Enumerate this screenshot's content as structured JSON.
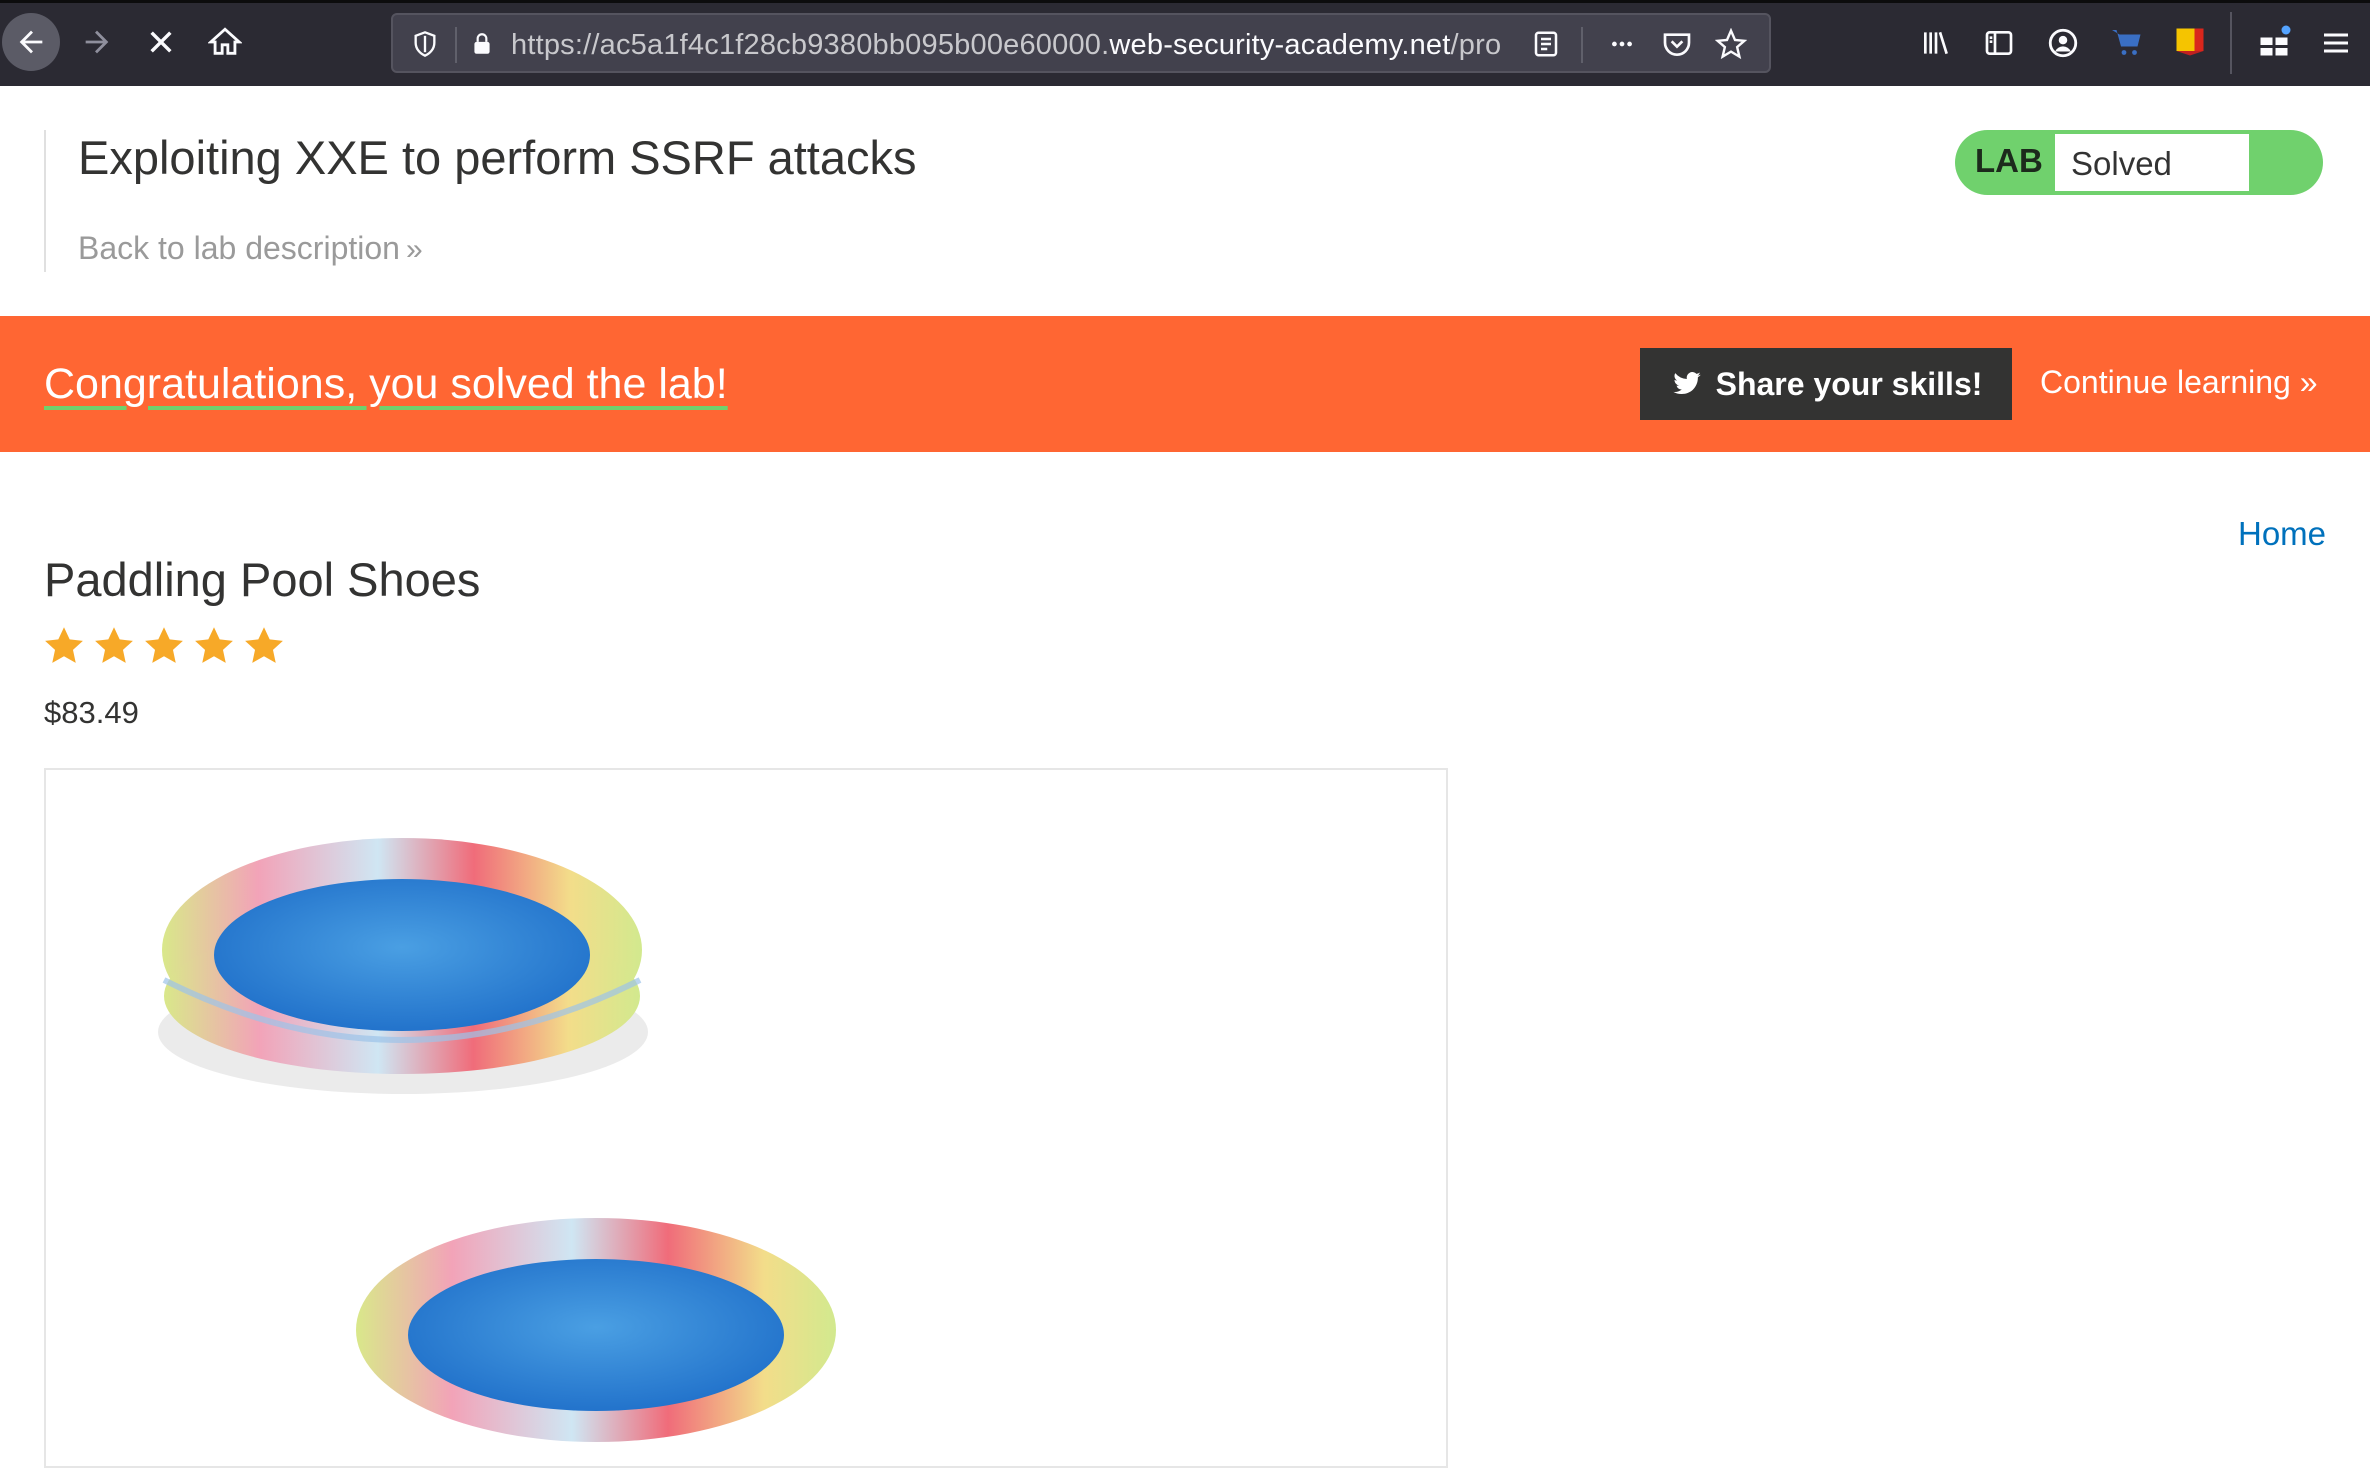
{
  "browser": {
    "url_prefix": "https://ac5a1f4c1f28cb9380bb095b00e60000.",
    "url_domain": "web-security-academy.net",
    "url_suffix": "/pro"
  },
  "header": {
    "title": "Exploiting XXE to perform SSRF attacks",
    "back_link": "Back to lab description",
    "status_label": "LAB",
    "status_value": "Solved"
  },
  "banner": {
    "message": "Congratulations, you solved the lab!",
    "share_label": "Share your skills!",
    "continue_label": "Continue learning"
  },
  "product": {
    "home_link": "Home",
    "name": "Paddling Pool Shoes",
    "rating": 5,
    "rating_max": 5,
    "price": "$83.49"
  },
  "colors": {
    "banner": "#ff6633",
    "lab_badge": "#70d16d",
    "star": "#f7a928",
    "link": "#0071bc"
  }
}
